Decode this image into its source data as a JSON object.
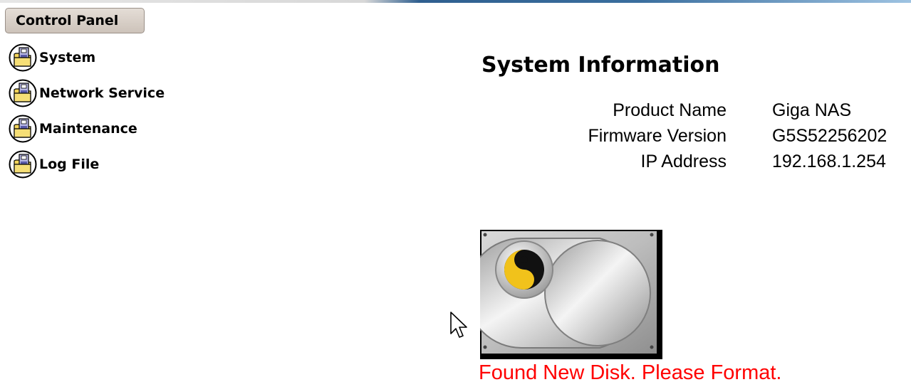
{
  "header": {
    "control_panel_label": "Control Panel"
  },
  "sidebar": {
    "items": [
      {
        "label": "System",
        "icon": "folder-disk-icon"
      },
      {
        "label": "Network Service",
        "icon": "folder-disk-icon"
      },
      {
        "label": "Maintenance",
        "icon": "folder-disk-icon"
      },
      {
        "label": "Log File",
        "icon": "folder-disk-icon"
      }
    ]
  },
  "main": {
    "title": "System Information",
    "info": [
      {
        "key": "Product Name",
        "value": "Giga NAS"
      },
      {
        "key": "Firmware Version",
        "value": "G5S52256202"
      },
      {
        "key": "IP Address",
        "value": "192.168.1.254"
      }
    ],
    "disk": {
      "icon": "hard-disk-icon",
      "message": "Found New Disk. Please Format.",
      "message_color": "#ff0000"
    }
  },
  "colors": {
    "accent_bar": "#2f5f8f",
    "button_bg": "#d6cec6"
  }
}
